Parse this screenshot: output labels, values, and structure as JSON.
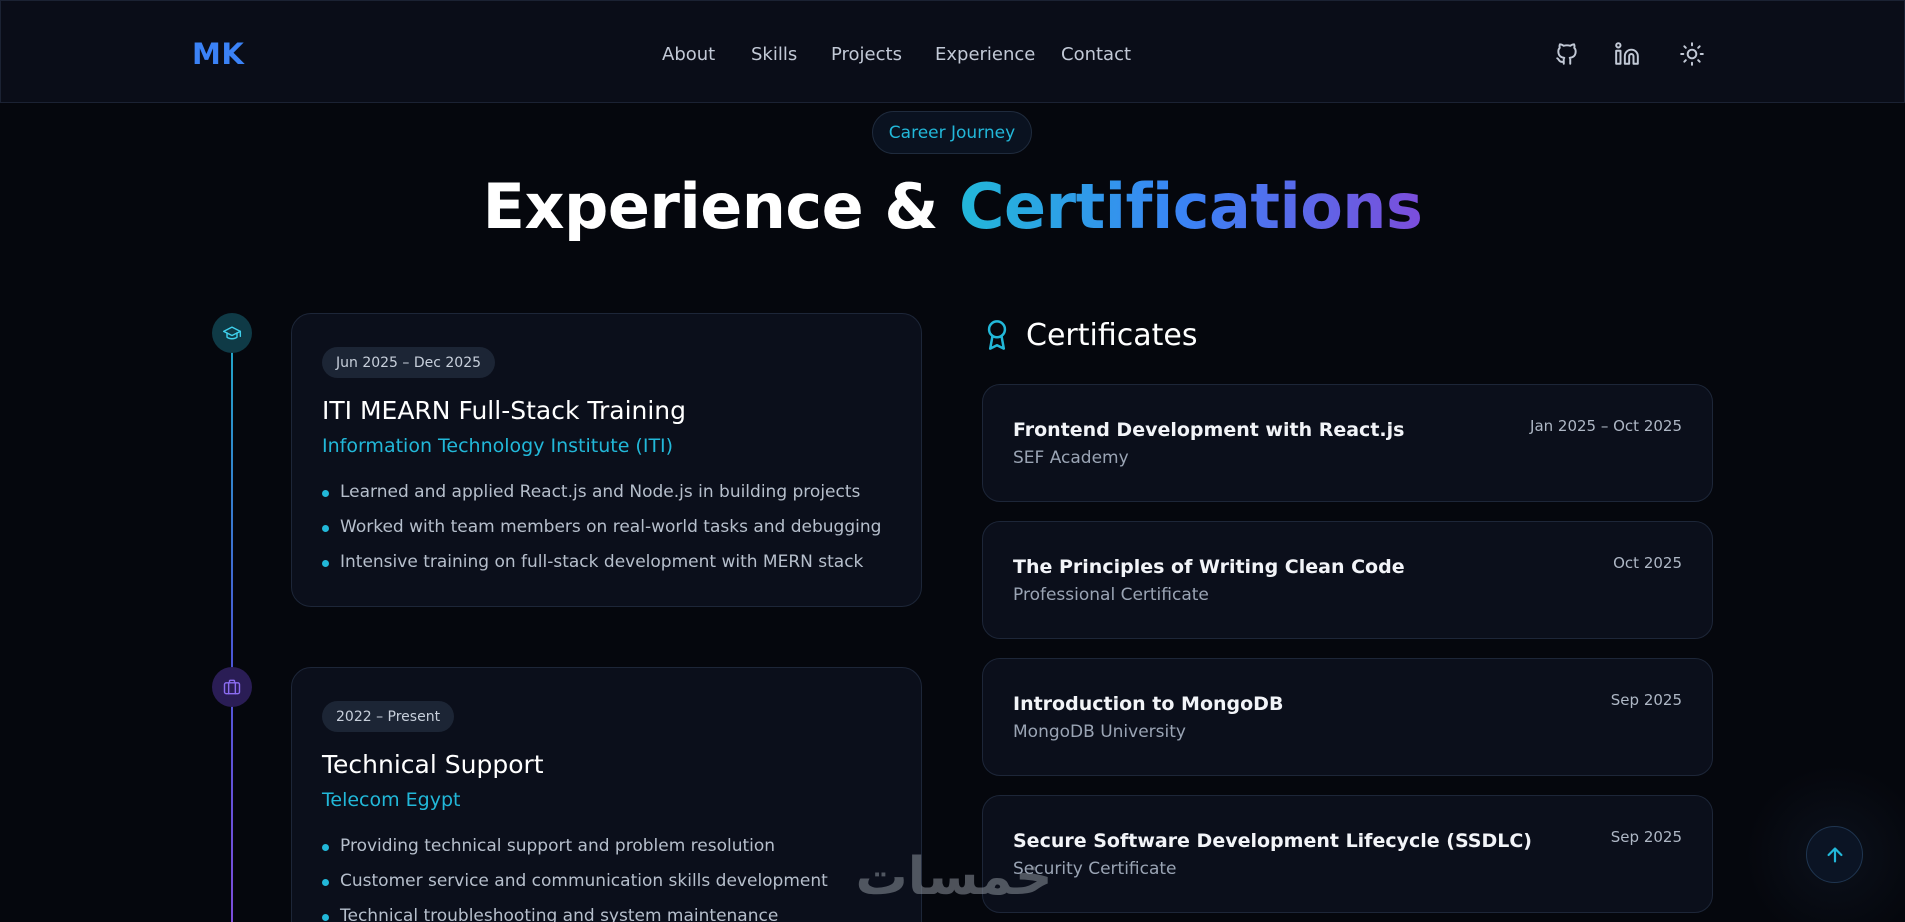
{
  "header": {
    "logo": "MK",
    "nav": [
      "About",
      "Skills",
      "Projects",
      "Experience",
      "Contact"
    ],
    "icons": [
      "github-icon",
      "linkedin-icon",
      "sun-icon"
    ]
  },
  "section": {
    "badge": "Career Journey",
    "title_plain": "Experience & ",
    "title_accent": "Certifications",
    "accent_colors": [
      "#22b8d9",
      "#3b82f6",
      "#7c4ddb"
    ]
  },
  "experience": [
    {
      "icon": "graduation-cap-icon",
      "date": "Jun 2025 – Dec 2025",
      "title": "ITI MEARN Full-Stack Training",
      "org": "Information Technology Institute (ITI)",
      "points": [
        "Learned and applied React.js and Node.js in building projects",
        "Worked with team members on real-world tasks and debugging",
        "Intensive training on full-stack development with MERN stack"
      ]
    },
    {
      "icon": "briefcase-icon",
      "date": "2022 – Present",
      "title": "Technical Support",
      "org": "Telecom Egypt",
      "points": [
        "Providing technical support and problem resolution",
        "Customer service and communication skills development",
        "Technical troubleshooting and system maintenance"
      ]
    }
  ],
  "certificates": {
    "heading": "Certificates",
    "icon": "award-icon",
    "items": [
      {
        "name": "Frontend Development with React.js",
        "issuer": "SEF Academy",
        "date": "Jan 2025 – Oct 2025"
      },
      {
        "name": "The Principles of Writing Clean Code",
        "issuer": "Professional Certificate",
        "date": "Oct 2025"
      },
      {
        "name": "Introduction to MongoDB",
        "issuer": "MongoDB University",
        "date": "Sep 2025"
      },
      {
        "name": "Secure Software Development Lifecycle (SSDLC)",
        "issuer": "Security Certificate",
        "date": "Sep 2025"
      }
    ]
  },
  "back_to_top": {
    "icon": "arrow-up-icon"
  },
  "watermark": {
    "text": "خمسات"
  }
}
